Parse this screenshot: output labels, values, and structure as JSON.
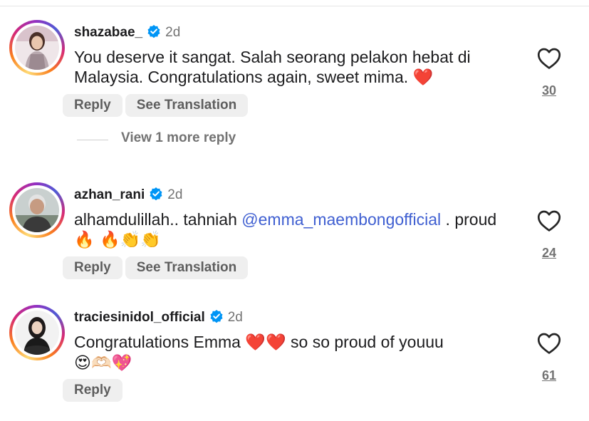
{
  "comments": [
    {
      "username": "shazabae_",
      "time": "2d",
      "text": "You deserve it sangat. Salah seorang pelakon hebat di Malaysia. Congratulations again, sweet mima.",
      "emoji": "❤️",
      "likes": "30",
      "reply_label": "Reply",
      "translate_label": "See Translation"
    },
    {
      "username": "azhan_rani",
      "time": "2d",
      "text_before": "alhamdulillah.. tahniah ",
      "mention": "@emma_maembongofficial",
      "text_after": " . proud ",
      "emoji": "🔥 🔥👏👏",
      "likes": "24",
      "reply_label": "Reply",
      "translate_label": "See Translation"
    },
    {
      "username": "traciesinidol_official",
      "time": "2d",
      "text_before": "Congratulations Emma ",
      "emoji_mid": "❤️❤️",
      "text_after": " so so proud of youuu",
      "emoji": "😍🫶🏻💖",
      "likes": "61",
      "reply_label": "Reply"
    }
  ],
  "view_more": "View 1 more reply",
  "icons": {
    "verified": "verified-badge-icon",
    "like": "heart-outline-icon"
  },
  "colors": {
    "verified_blue": "#0095f6",
    "mention": "#3f5fd1",
    "muted": "#737373",
    "pill_bg": "#efefef"
  }
}
